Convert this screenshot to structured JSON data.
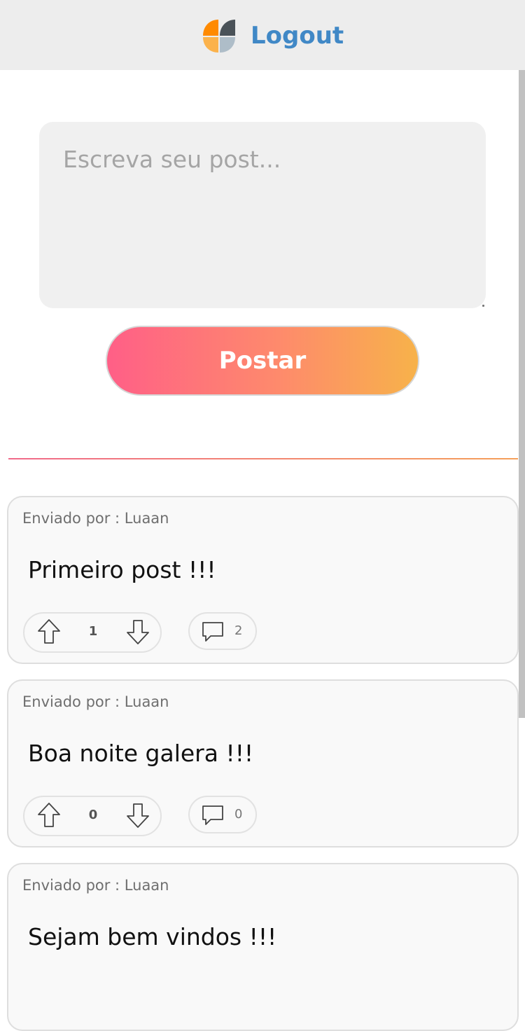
{
  "header": {
    "logout_label": "Logout",
    "logo_colors": [
      "#ff8a00",
      "#4a5258",
      "#fbb24b",
      "#aebdc8"
    ]
  },
  "composer": {
    "placeholder": "Escreva seu post...",
    "value": "",
    "submit_label": "Postar"
  },
  "posts": [
    {
      "author": "Enviado por : Luaan",
      "text": "Primeiro post !!!",
      "votes": "1",
      "comments": "2"
    },
    {
      "author": "Enviado por : Luaan",
      "text": "Boa noite galera !!!",
      "votes": "0",
      "comments": "0"
    },
    {
      "author": "Enviado por : Luaan",
      "text": "Sejam bem vindos !!!",
      "votes": "",
      "comments": ""
    }
  ],
  "icons": {
    "upvote": "arrow-up-icon",
    "downvote": "arrow-down-icon",
    "comment": "speech-bubble-icon"
  }
}
